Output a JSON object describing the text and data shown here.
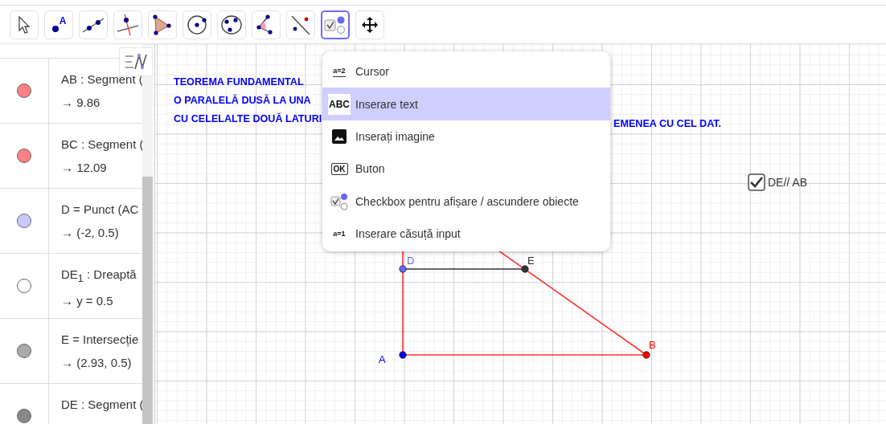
{
  "toolbar": {
    "tools": [
      {
        "kind": "move",
        "selected": false
      },
      {
        "kind": "point",
        "glyph": "A",
        "selected": false
      },
      {
        "kind": "line",
        "selected": false
      },
      {
        "kind": "perpendicular",
        "selected": false
      },
      {
        "kind": "polygon",
        "selected": false
      },
      {
        "kind": "circle",
        "selected": false
      },
      {
        "kind": "circle3",
        "selected": false
      },
      {
        "kind": "angle",
        "selected": false
      },
      {
        "kind": "reflect",
        "selected": false
      },
      {
        "kind": "checkbox",
        "selected": true
      },
      {
        "kind": "pan",
        "selected": false
      }
    ]
  },
  "algebra": {
    "items": [
      {
        "color": "#ff8080",
        "definition": "AB : Segment (",
        "value": "→  9.86"
      },
      {
        "color": "#ff8080",
        "definition": "BC : Segment (",
        "value": "→  12.09"
      },
      {
        "color": "#c8c8ff",
        "definition": "D = Punct (AC",
        "value": "→  (-2, 0.5)"
      },
      {
        "color": "#ffffff",
        "definition": "DE$_{1}$ : Dreaptă",
        "value": "→  y = 0.5"
      },
      {
        "color": "#aaaaaa",
        "definition": "E = Intersecție",
        "value": "→  (2.93, 0.5)"
      },
      {
        "color": "#888888",
        "definition": "DE : Segment ("
      }
    ]
  },
  "graphics": {
    "text_lines": [
      "TEOREMA FUNDAMENTAL",
      "O PARALELĂ DUSĂ LA UNA",
      "CU CELELALTE DOUĂ LATURI"
    ],
    "text_tail": "EMENEA CU CEL DAT.",
    "points": [
      {
        "label": "A",
        "color": "#0000ff"
      },
      {
        "label": "B",
        "color": "#ff0000"
      },
      {
        "label": "D",
        "color": "#6666ff"
      },
      {
        "label": "E",
        "color": "#333333"
      }
    ],
    "checkbox": {
      "label": "DE// AB",
      "checked": true
    }
  },
  "menu": {
    "items": [
      {
        "kind": "slider",
        "icon_text": "a=2",
        "label": "Cursor",
        "selected": false
      },
      {
        "kind": "text",
        "icon_text": "ABC",
        "label": "Inserare text",
        "selected": true
      },
      {
        "kind": "image",
        "label": "Inserați imagine",
        "selected": false
      },
      {
        "kind": "button",
        "icon_text": "OK",
        "label": "Buton",
        "selected": false
      },
      {
        "kind": "checkbox",
        "label": "Checkbox pentru afișare / ascundere obiecte",
        "selected": false
      },
      {
        "kind": "input",
        "icon_text": "a=1",
        "label": "Inserare căsuță input",
        "selected": false
      }
    ]
  }
}
